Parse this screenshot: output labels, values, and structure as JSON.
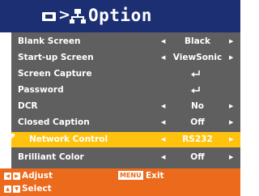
{
  "header": {
    "chevron": ">",
    "title": "Option",
    "screen_icon": "screen-icon",
    "network_icon": "network-icon"
  },
  "menu": {
    "items": [
      {
        "label": "Blank Screen",
        "value": "Black",
        "left_arrow": "◀",
        "right_arrow": "▶"
      },
      {
        "label": "Start-up Screen",
        "value": "ViewSonic",
        "left_arrow": "◀",
        "right_arrow": "▶"
      },
      {
        "label": "Screen Capture",
        "value": "",
        "left_arrow": "",
        "right_arrow": "",
        "icon": "enter-icon"
      },
      {
        "label": "Password",
        "value": "",
        "left_arrow": "",
        "right_arrow": "",
        "icon": "enter-icon"
      },
      {
        "label": "DCR",
        "value": "No",
        "left_arrow": "◀",
        "right_arrow": "▶"
      },
      {
        "label": "Closed Caption",
        "value": "Off",
        "left_arrow": "◀",
        "right_arrow": "▶"
      },
      {
        "label": "Network Control",
        "value": "RS232",
        "left_arrow": "◀",
        "right_arrow": "▶",
        "selected": true,
        "icon": "network-control-icon"
      },
      {
        "label": "Brilliant Color",
        "value": "Off",
        "left_arrow": "◀",
        "right_arrow": "▶"
      }
    ]
  },
  "footer": {
    "adjust_label": "Adjust",
    "select_label": "Select",
    "menu_key": "MENU",
    "exit_label": "Exit",
    "left_key": "◀",
    "right_key": "▶",
    "up_key": "▲",
    "down_key": "▼"
  },
  "colors": {
    "header_bg": "#1c2f73",
    "menu_bg": "#5f5f5f",
    "selected_bg": "#ffc20e",
    "footer_bg": "#ec6a1c"
  }
}
